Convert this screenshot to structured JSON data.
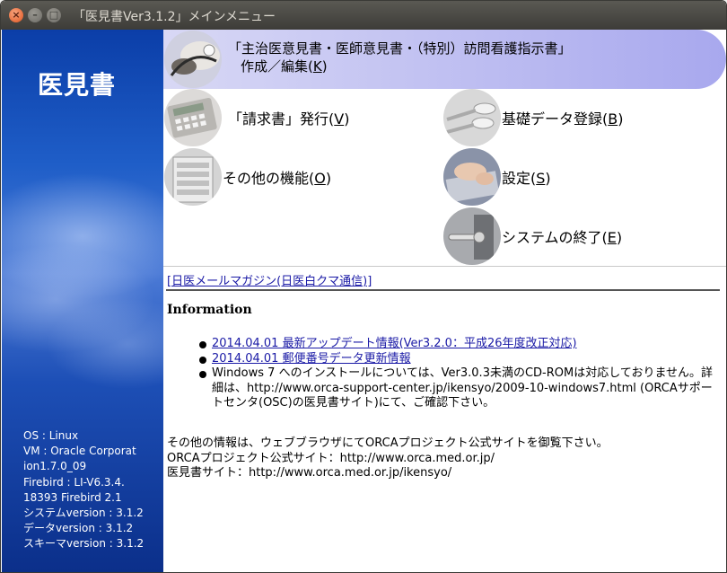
{
  "window": {
    "title": "「医見書Ver3.1.2」メインメニュー",
    "close_glyph": "×",
    "min_glyph": "–",
    "max_glyph": "□"
  },
  "sidebar": {
    "logo": "医見書",
    "sysinfo": [
      "OS : Linux",
      "VM : Oracle Corporat",
      "ion1.7.0_09",
      "Firebird : LI-V6.3.4.",
      "18393 Firebird 2.1",
      "システムversion : 3.1.2",
      "データversion : 3.1.2",
      "スキーマversion : 3.1.2"
    ]
  },
  "menu": {
    "main_line1": "「主治医意見書・医師意見書・（特別）訪問看護指示書」",
    "main_line2_pre": "作成／編集(",
    "main_line2_key": "K",
    "main_line2_post": ")",
    "invoice_pre": "「請求書」発行(",
    "invoice_key": "V",
    "invoice_post": ")",
    "master_pre": "基礎データ登録(",
    "master_key": "B",
    "master_post": ")",
    "other_pre": "その他の機能(",
    "other_key": "O",
    "other_post": ")",
    "settings_pre": "設定(",
    "settings_key": "S",
    "settings_post": ")",
    "exit_pre": "システムの終了(",
    "exit_key": "E",
    "exit_post": ")"
  },
  "content": {
    "magazine_link": "[日医メールマガジン(日医白クマ通信)]",
    "info_heading": "Information",
    "news": [
      {
        "text": "2014.04.01 最新アップデート情報(Ver3.2.0：平成26年度改正対応)",
        "link": true
      },
      {
        "text": "2014.04.01 郵便番号データ更新情報",
        "link": true
      },
      {
        "text": "Windows 7 へのインストールについては、Ver3.0.3未満のCD-ROMは対応しておりません。詳細は、http://www.orca-support-center.jp/ikensyo/2009-10-windows7.html (ORCAサポートセンタ(OSC)の医見書サイト)にて、ご確認下さい。",
        "link": false
      }
    ],
    "footer": [
      "その他の情報は、ウェブブラウザにてORCAプロジェクト公式サイトを御覧下さい。",
      "ORCAプロジェクト公式サイト：http://www.orca.med.or.jp/",
      "医見書サイト：http://www.orca.med.or.jp/ikensyo/"
    ]
  }
}
